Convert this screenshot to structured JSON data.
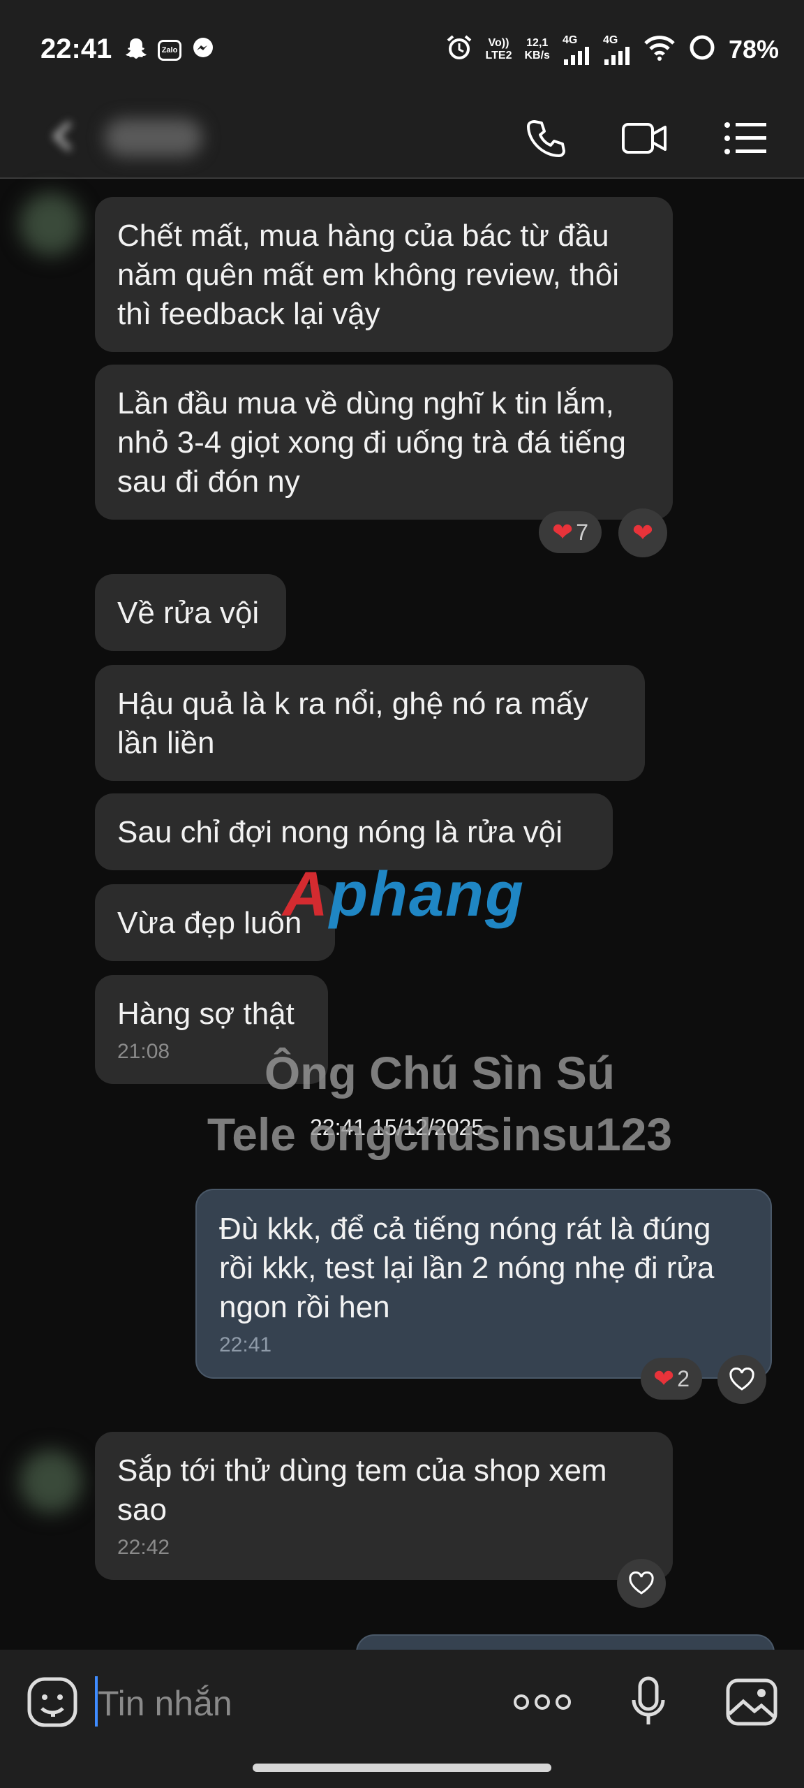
{
  "status_bar": {
    "time": "22:41",
    "app_icons": [
      "snapchat-icon",
      "zalo-icon",
      "messenger-icon"
    ],
    "zalo_label": "Zalo",
    "volte": "Vo))",
    "volte_sub": "LTE2",
    "net_speed": "12,1",
    "net_unit": "KB/s",
    "net1": "4G",
    "net2": "4G",
    "battery": "78%"
  },
  "header": {
    "icons": [
      "back-arrow-icon",
      "phone-icon",
      "video-call-icon",
      "menu-list-icon"
    ]
  },
  "messages": [
    {
      "text": "Chết mất, mua hàng của bác từ đầu năm quên mất em  không review, thôi thì feedback lại vậy"
    },
    {
      "text": "Lần đầu mua về dùng nghĩ k tin lắm, nhỏ 3-4 giọt xong đi uống trà đá tiếng sau đi đón ny"
    },
    {
      "text": "Về rửa vội"
    },
    {
      "text": "Hậu quả là k ra nổi, ghệ nó ra mấy lần liền"
    },
    {
      "text": "Sau chỉ đợi nong nóng là rửa vội"
    },
    {
      "text": "Vừa đẹp luôn"
    },
    {
      "text": "Hàng sợ thật",
      "time": "21:08"
    },
    {
      "text": "Đù kkk, để cả tiếng nóng rát là đúng rồi kkk, test lại lần 2 nóng nhẹ đi rửa ngon rồi hen",
      "time": "22:41"
    },
    {
      "text": "Sắp tới thử dùng tem của shop xem sao",
      "time": "22:42"
    }
  ],
  "reactions": {
    "msg2_count": "7",
    "msg8_count": "2"
  },
  "date_divider": "22:41 15/12/2025",
  "watermark": {
    "logo_first": "A",
    "logo_rest": "phang",
    "line1": "Ông Chú Sìn Sú",
    "line2": "Tele ongchusinsu123"
  },
  "input": {
    "placeholder": "Tin nhắn",
    "icons": [
      "sticker-icon",
      "more-icon",
      "microphone-icon",
      "image-icon"
    ]
  },
  "colors": {
    "background": "#0d0d0d",
    "incoming_bubble": "#2c2c2c",
    "outgoing_bubble": "#364250",
    "heart": "#e8333a",
    "caret": "#3f8cff"
  }
}
